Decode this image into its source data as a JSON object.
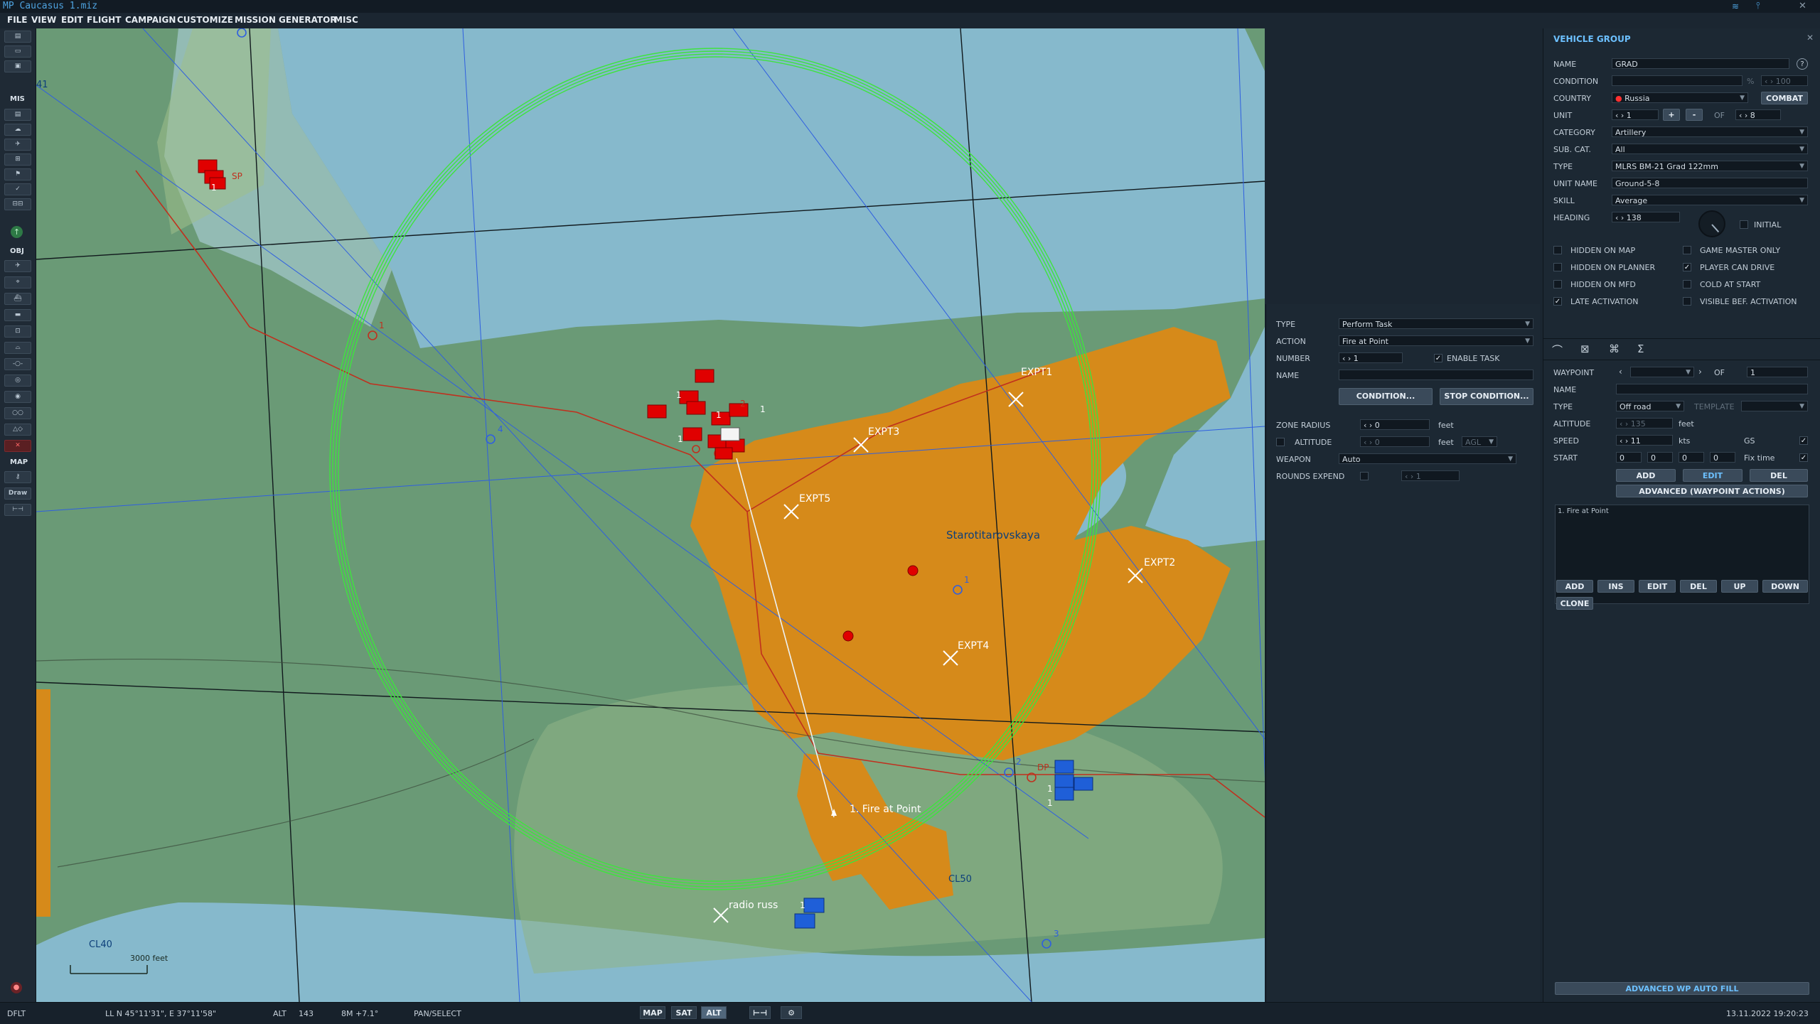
{
  "title": "MP Caucasus 1.miz",
  "menu": [
    "FILE",
    "VIEW",
    "EDIT",
    "FLIGHT",
    "CAMPAIGN",
    "CUSTOMIZE",
    "MISSION GENERATOR",
    "MISC"
  ],
  "toolbar": {
    "mis_label": "MIS",
    "obj_label": "OBJ",
    "map_label": "MAP",
    "draw_label": "Draw"
  },
  "map": {
    "city": "Starotitarovskaya",
    "points": [
      "EXPT1",
      "EXPT2",
      "EXPT3",
      "EXPT4",
      "EXPT5",
      "radio russ"
    ],
    "fire_label": "1. Fire at Point",
    "grid": [
      "CL40",
      "CL50",
      "41"
    ],
    "scale": "3000 feet",
    "red_wp_numbers": [
      "1",
      "2"
    ],
    "blue_wp_numbers": [
      "1",
      "2",
      "3",
      "4"
    ],
    "markers": [
      "SP",
      "DP"
    ],
    "group_numbers": [
      "1",
      "1",
      "1",
      "1",
      "1",
      "1",
      "1",
      "1"
    ]
  },
  "task": {
    "type_label": "TYPE",
    "type_value": "Perform Task",
    "action_label": "ACTION",
    "action_value": "Fire at Point",
    "number_label": "NUMBER",
    "number_value": "1",
    "enable_task": "ENABLE TASK",
    "name_label": "NAME",
    "name_value": "",
    "condition_btn": "CONDITION...",
    "stop_condition_btn": "STOP CONDITION...",
    "zone_radius_label": "ZONE RADIUS",
    "zone_radius_value": "0",
    "zone_radius_unit": "feet",
    "altitude_label": "ALTITUDE",
    "altitude_value": "0",
    "altitude_unit": "feet",
    "altitude_ref": "AGL",
    "weapon_label": "WEAPON",
    "weapon_value": "Auto",
    "rounds_label": "ROUNDS EXPEND",
    "rounds_value": "1"
  },
  "group": {
    "header": "VEHICLE GROUP",
    "name_label": "NAME",
    "name_value": "GRAD",
    "help": "?",
    "condition_label": "CONDITION",
    "condition_unit": "%",
    "condition_value": "100",
    "country_label": "COUNTRY",
    "country_value": "Russia",
    "combat_btn": "COMBAT",
    "unit_label": "UNIT",
    "unit_value": "1",
    "unit_of_label": "OF",
    "unit_of_value": "8",
    "category_label": "CATEGORY",
    "category_value": "Artillery",
    "subcat_label": "SUB. CAT.",
    "subcat_value": "All",
    "type_label": "TYPE",
    "type_value": "MLRS BM-21 Grad 122mm",
    "unit_name_label": "UNIT NAME",
    "unit_name_value": "Ground-5-8",
    "skill_label": "SKILL",
    "skill_value": "Average",
    "heading_label": "HEADING",
    "heading_value": "138",
    "initial_label": "INITIAL",
    "checks": [
      {
        "label": "HIDDEN ON MAP",
        "checked": false
      },
      {
        "label": "GAME MASTER ONLY",
        "checked": false
      },
      {
        "label": "HIDDEN ON PLANNER",
        "checked": false
      },
      {
        "label": "PLAYER CAN DRIVE",
        "checked": true
      },
      {
        "label": "HIDDEN ON MFD",
        "checked": false
      },
      {
        "label": "COLD AT START",
        "checked": false
      },
      {
        "label": "LATE ACTIVATION",
        "checked": true
      },
      {
        "label": "VISIBLE BEF. ACTIVATION",
        "checked": false
      }
    ]
  },
  "waypoint": {
    "waypoint_label": "WAYPOINT",
    "of_label": "OF",
    "of_value": "1",
    "name_label": "NAME",
    "type_label": "TYPE",
    "type_value": "Off road",
    "template_label": "TEMPLATE",
    "altitude_label": "ALTITUDE",
    "altitude_value": "135",
    "altitude_unit": "feet",
    "speed_label": "SPEED",
    "speed_value": "11",
    "speed_unit": "kts",
    "gs_label": "GS",
    "start_label": "START",
    "start_h": "0",
    "start_m": "0",
    "start_s": "0",
    "start_d": "0",
    "fix_time": "Fix time",
    "add_btn": "ADD",
    "edit_btn": "EDIT",
    "del_btn": "DEL",
    "advanced_btn": "ADVANCED (WAYPOINT ACTIONS)",
    "actions": [
      "1. Fire at Point"
    ],
    "list_buttons": [
      "ADD",
      "INS",
      "EDIT",
      "DEL",
      "UP",
      "DOWN",
      "CLONE"
    ],
    "autofill_btn": "ADVANCED WP AUTO FILL"
  },
  "status": {
    "mode": "DFLT",
    "coords": "LL  N 45°11'31\", E 37°11'58\"",
    "alt_label": "ALT",
    "alt_value": "143",
    "mag": "8M  +7.1°",
    "tool": "PAN/SELECT",
    "map_btn": "MAP",
    "sat_btn": "SAT",
    "alt_btn": "ALT",
    "datetime": "13.11.2022 19:20:23"
  },
  "colors": {
    "red": "#e00000",
    "blue": "#1f5fd8",
    "green_ring": "#3fe33f",
    "town": "#d68a1a",
    "water": "#86b9cc",
    "land": "#6a9a76"
  }
}
